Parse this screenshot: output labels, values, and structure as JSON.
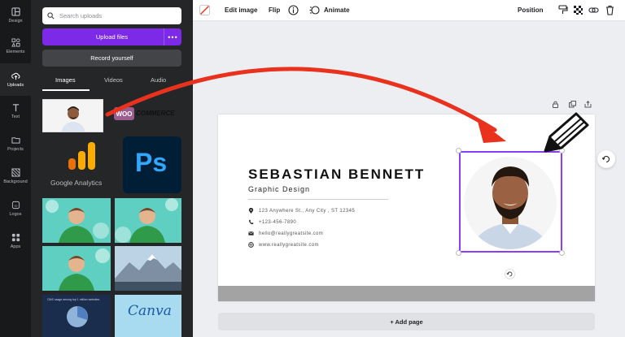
{
  "rail": {
    "items": [
      {
        "label": "Design",
        "icon": "layout-icon"
      },
      {
        "label": "Elements",
        "icon": "shapes-icon"
      },
      {
        "label": "Uploads",
        "icon": "cloud-upload-icon"
      },
      {
        "label": "Text",
        "icon": "text-icon"
      },
      {
        "label": "Projects",
        "icon": "folder-icon"
      },
      {
        "label": "Background",
        "icon": "pattern-icon"
      },
      {
        "label": "Logos",
        "icon": "logo-icon"
      },
      {
        "label": "Apps",
        "icon": "apps-grid-icon"
      }
    ],
    "active": "Uploads"
  },
  "panel": {
    "search_placeholder": "Search uploads",
    "upload_label": "Upload files",
    "upload_more": "•••",
    "record_label": "Record yourself",
    "tabs": [
      "Images",
      "Videos",
      "Audio"
    ],
    "active_tab": "Images",
    "thumb_texts": {
      "woocommerce_woo": "WOO",
      "woocommerce_rest": "COMMERCE",
      "google_analytics": "Google Analytics",
      "photoshop": "Ps",
      "canva": "Canva",
      "report_title": "CMS usage among top 1 million websites"
    }
  },
  "toolbar": {
    "edit_image": "Edit image",
    "flip": "Flip",
    "animate": "Animate",
    "position": "Position"
  },
  "card": {
    "name": "SEBASTIAN BENNETT",
    "role": "Graphic Design",
    "address": "123 Anywhere St., Any City , ST 12345",
    "phone": "+123-456-7890",
    "email": "hello@reallygreatsite.com",
    "website": "www.reallygreatsite.com"
  },
  "add_page": "+ Add page",
  "colors": {
    "accent": "#7d2ae8",
    "selection": "#8b3dff",
    "arrow": "#e8321e",
    "rail_bg": "#18191b",
    "panel_bg": "#252627"
  }
}
